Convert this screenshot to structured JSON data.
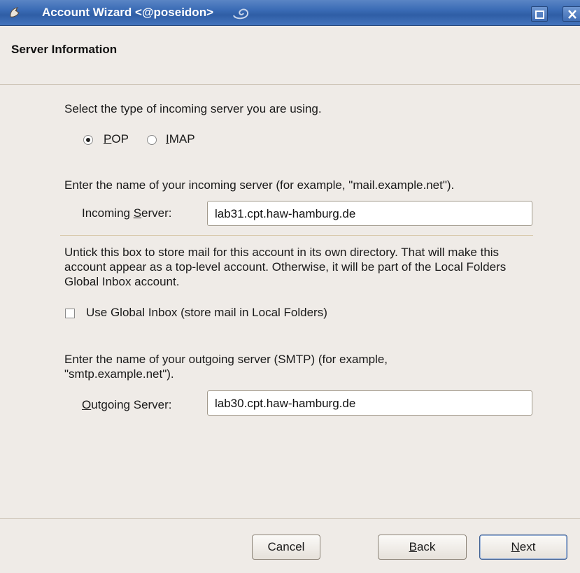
{
  "window": {
    "title": "Account Wizard <@poseidon>",
    "icon": "seamonkey-icon",
    "controls": [
      "maximize-icon",
      "close-icon"
    ]
  },
  "header": {
    "title": "Server Information"
  },
  "incoming_type": {
    "prompt": "Select the type of incoming server you are using.",
    "options": [
      {
        "mnemonic": "P",
        "rest": "OP",
        "selected": true
      },
      {
        "mnemonic": "I",
        "rest": "MAP",
        "selected": false
      }
    ]
  },
  "incoming_server": {
    "prompt": "Enter the name of your incoming server (for example, \"mail.example.net\").",
    "label_pre": "Incoming ",
    "label_mnemonic": "S",
    "label_post": "erver:",
    "value": "lab31.cpt.haw-hamburg.de"
  },
  "global_inbox": {
    "description": "Untick this box to store mail for this account in its own directory. That will make this account appear as a top-level account. Otherwise, it will be part of the Local Folders Global Inbox account.",
    "checkbox_label": "Use Global Inbox (store mail in Local Folders)",
    "checked": false
  },
  "outgoing_server": {
    "prompt": "Enter the name of your outgoing server (SMTP) (for example, \"smtp.example.net\").",
    "label_mnemonic": "O",
    "label_post": "utgoing Server:",
    "value": "lab30.cpt.haw-hamburg.de"
  },
  "buttons": {
    "cancel": "Cancel",
    "back_mnemonic": "B",
    "back_rest": "ack",
    "next_mnemonic": "N",
    "next_rest": "ext"
  },
  "colors": {
    "titlebar": "#3a6bb5",
    "background": "#efebe7",
    "separator": "#d8c9ad"
  }
}
